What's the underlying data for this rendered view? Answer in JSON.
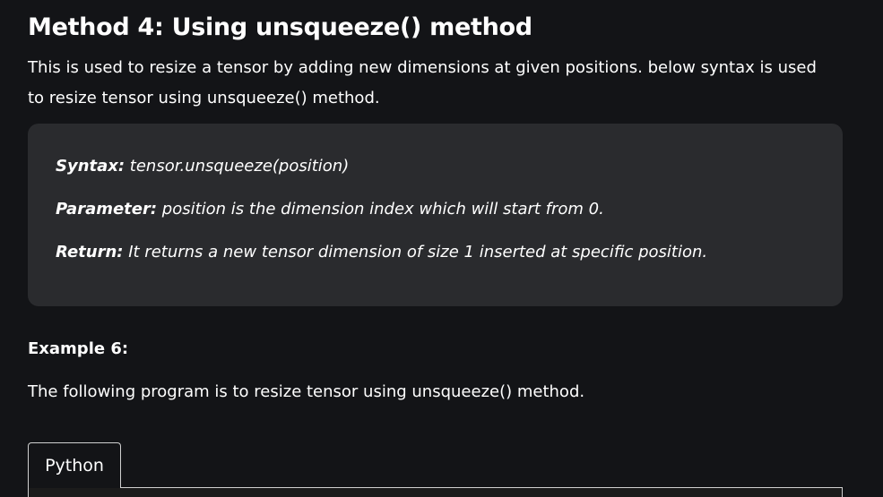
{
  "section": {
    "title": "Method 4: Using unsqueeze() method",
    "intro": "This is used to resize a tensor by adding new dimensions at given positions. below syntax is used to resize tensor using unsqueeze() method."
  },
  "syntax_box": {
    "syntax_label": "Syntax:",
    "syntax_value": " tensor.unsqueeze(position)",
    "parameter_label": "Parameter:",
    "parameter_value": " position is the dimension index which will start from 0.",
    "return_label": "Return:",
    "return_value": " It returns a new tensor dimension of size 1 inserted at specific position."
  },
  "example": {
    "heading": "Example 6:",
    "description": "The following program is to resize tensor using unsqueeze() method."
  },
  "code_block": {
    "tabs": [
      {
        "label": "Python"
      }
    ]
  }
}
